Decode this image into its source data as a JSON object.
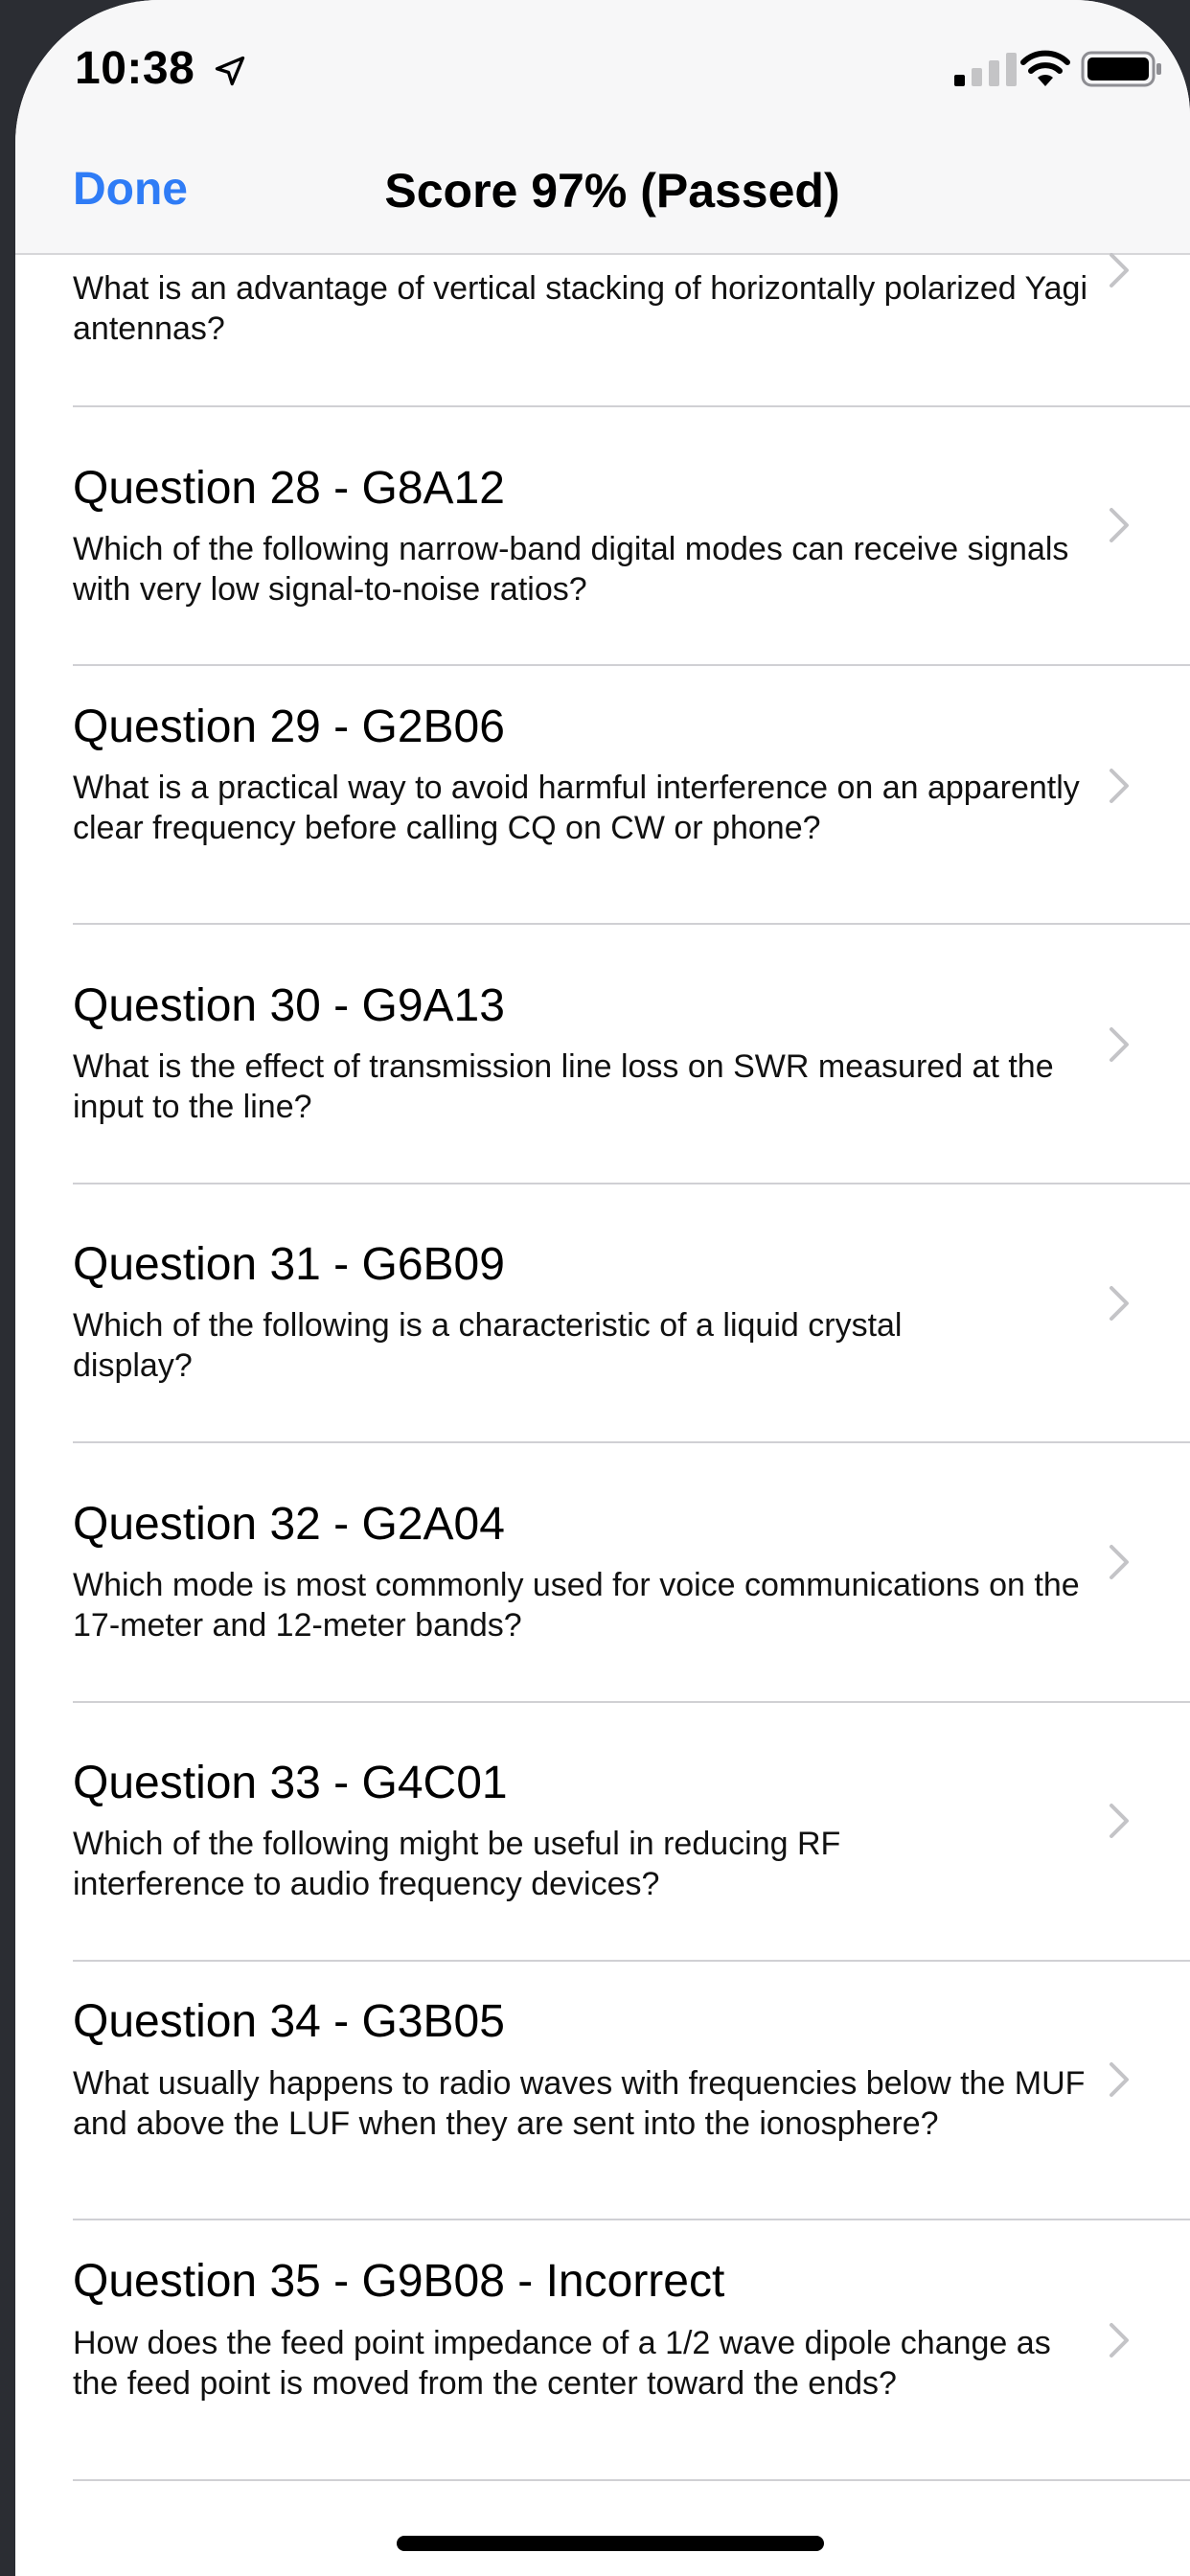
{
  "status_bar": {
    "time": "10:38"
  },
  "nav": {
    "done_label": "Done",
    "title": "Score 97% (Passed)"
  },
  "accent_color": "#2f7cf6",
  "questions": [
    {
      "title": "",
      "text": "What is an advantage of vertical stacking of horizontally polarized Yagi antennas?"
    },
    {
      "title": "Question 28 - G8A12",
      "text": "Which of the following narrow-band digital modes can receive signals with very low signal-to-noise ratios?"
    },
    {
      "title": "Question 29 - G2B06",
      "text": "What is a practical way to avoid harmful interference on an apparently clear frequency before calling CQ on CW or phone?"
    },
    {
      "title": "Question 30 - G9A13",
      "text": "What is the effect of transmission line loss on SWR measured at the input to the line?"
    },
    {
      "title": "Question 31 - G6B09",
      "text": "Which of the following is a characteristic of a liquid crystal display?"
    },
    {
      "title": "Question 32 - G2A04",
      "text": "Which mode is most commonly used for voice communications on the 17-meter and 12-meter bands?"
    },
    {
      "title": "Question 33 - G4C01",
      "text": "Which of the following might be useful in reducing RF interference to audio frequency devices?"
    },
    {
      "title": "Question 34 - G3B05",
      "text": "What usually happens to radio waves with frequencies below the MUF and above the LUF when they are sent into the ionosphere?"
    },
    {
      "title": "Question 35 - G9B08 - Incorrect",
      "text": "How does the feed point impedance of a 1/2 wave dipole change as the feed point is moved from the center toward the ends?"
    }
  ]
}
